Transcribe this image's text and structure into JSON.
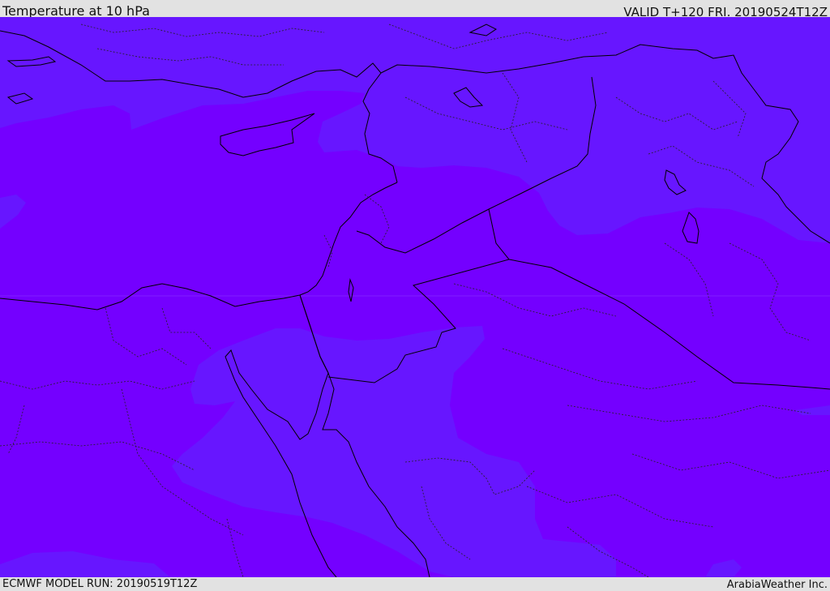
{
  "header": {
    "title": "Temperature at 10 hPa",
    "valid_time": "VALID T+120 FRI. 20190524T12Z"
  },
  "footer": {
    "model_run": "ECMWF MODEL RUN: 20190519T12Z",
    "credit": "ArabiaWeather Inc."
  },
  "map": {
    "region": "Eastern Mediterranean / Middle East",
    "colors": {
      "warm_band": "#7400ff",
      "cool_band": "#6716ff",
      "border": "#000000",
      "admin_border": "#222222"
    }
  }
}
